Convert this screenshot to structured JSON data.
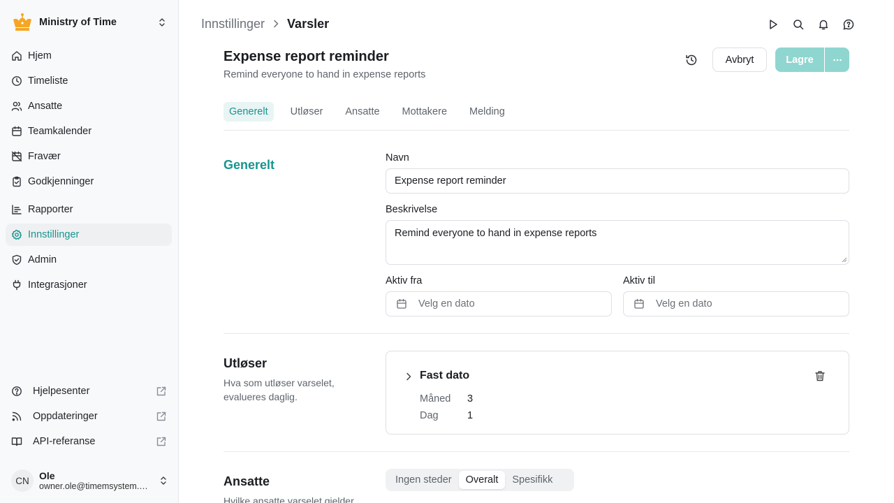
{
  "org": {
    "name": "Ministry of Time",
    "logo_icon": "crown-icon",
    "brand_color": "#f5a623"
  },
  "nav": {
    "items": [
      {
        "label": "Hjem",
        "icon": "home-icon"
      },
      {
        "label": "Timeliste",
        "icon": "clock-icon"
      },
      {
        "label": "Ansatte",
        "icon": "users-icon"
      },
      {
        "label": "Teamkalender",
        "icon": "calendar-icon"
      },
      {
        "label": "Fravær",
        "icon": "calendar-off-icon"
      },
      {
        "label": "Godkjenninger",
        "icon": "clipboard-check-icon"
      },
      {
        "label": "Rapporter",
        "icon": "report-icon"
      },
      {
        "label": "Innstillinger",
        "icon": "gear-icon",
        "active": true
      },
      {
        "label": "Admin",
        "icon": "shield-check-icon"
      },
      {
        "label": "Integrasjoner",
        "icon": "plug-icon"
      }
    ]
  },
  "footer_links": [
    {
      "label": "Hjelpesenter",
      "icon": "help-circle-icon"
    },
    {
      "label": "Oppdateringer",
      "icon": "rss-icon"
    },
    {
      "label": "API-referanse",
      "icon": "book-icon"
    }
  ],
  "user": {
    "initials": "CN",
    "name": "Ole",
    "email": "owner.ole@timemsystem.com"
  },
  "breadcrumb": {
    "parent": "Innstillinger",
    "current": "Varsler"
  },
  "page": {
    "title": "Expense report reminder",
    "subtitle": "Remind everyone to hand in expense reports",
    "cancel_label": "Avbryt",
    "save_label": "Lagre"
  },
  "tabs": [
    "Generelt",
    "Utløser",
    "Ansatte",
    "Mottakere",
    "Melding"
  ],
  "general": {
    "title": "Generelt",
    "name_label": "Navn",
    "name_value": "Expense report reminder",
    "desc_label": "Beskrivelse",
    "desc_value": "Remind everyone to hand in expense reports",
    "from_label": "Aktiv fra",
    "from_placeholder": "Velg en dato",
    "to_label": "Aktiv til",
    "to_placeholder": "Velg en dato"
  },
  "trigger": {
    "title": "Utløser",
    "desc": "Hva som utløser varselet, evalueres daglig.",
    "card_title": "Fast dato",
    "month_label": "Måned",
    "month_value": "3",
    "day_label": "Dag",
    "day_value": "1"
  },
  "employees": {
    "title": "Ansatte",
    "desc": "Hvilke ansatte varselet gjelder",
    "options": [
      "Ingen steder",
      "Overalt",
      "Spesifikk"
    ],
    "selected": "Overalt"
  },
  "colors": {
    "accent": "#17958e",
    "save_button": "#8fd6d0"
  }
}
